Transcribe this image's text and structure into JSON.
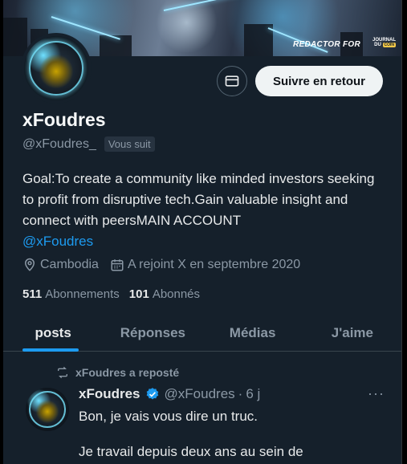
{
  "banner": {
    "text": "REDACTOR FOR",
    "logo_top": "JOURNAL",
    "logo_mid": "DU",
    "logo_coin": "COIN"
  },
  "profile": {
    "name": "xFoudres",
    "handle": "@xFoudres_",
    "follows_you": "Vous suit",
    "bio": "Goal:To create a community like minded investors seeking to profit from disruptive tech.Gain valuable insight and connect with peersMAIN ACCOUNT",
    "bio_mention": "@xFoudres",
    "location": "Cambodia",
    "joined": "A rejoint X en septembre 2020",
    "following_count": "511",
    "following_label": "Abonnements",
    "followers_count": "101",
    "followers_label": "Abonnés"
  },
  "actions": {
    "follow_back": "Suivre en retour",
    "message_icon": "envelope-icon"
  },
  "tabs": [
    {
      "label": "posts",
      "active": true
    },
    {
      "label": "Réponses",
      "active": false
    },
    {
      "label": "Médias",
      "active": false
    },
    {
      "label": "J'aime",
      "active": false
    }
  ],
  "post": {
    "repost_label": "xFoudres a reposté",
    "author_name": "xFoudres",
    "author_handle": "@xFoudres",
    "separator": "·",
    "time": "6 j",
    "more": "···",
    "lines": [
      "Bon, je vais vous dire un truc.",
      "Je travail depuis deux ans au sein de"
    ]
  },
  "colors": {
    "background": "#15202b",
    "accent": "#1d9bf0",
    "muted": "#8b98a5"
  }
}
